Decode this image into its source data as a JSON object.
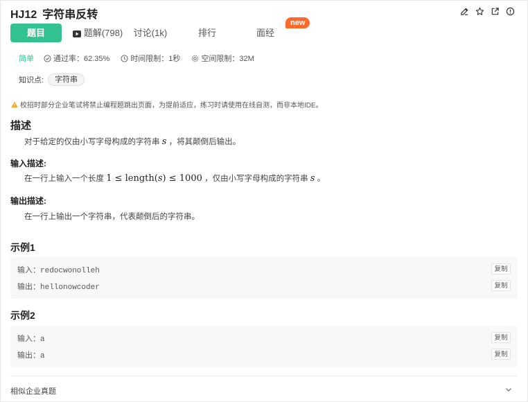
{
  "problem": {
    "id": "HJ12",
    "title": "字符串反转"
  },
  "tabs": [
    {
      "label": "题目",
      "active": true
    },
    {
      "label": "题解(798)",
      "active": false
    },
    {
      "label": "讨论(1k)",
      "active": false
    },
    {
      "label": "排行",
      "active": false
    },
    {
      "label": "面经",
      "active": false
    }
  ],
  "new_badge": "new",
  "meta": {
    "difficulty": "简单",
    "pass_rate": "通过率：62.35%",
    "time_limit": "时间限制：1秒",
    "memory_limit": "空间限制：32M"
  },
  "knowledge": {
    "label": "知识点:",
    "tag": "字符串"
  },
  "warning": "校招时部分企业笔试将禁止编程题跳出页面，为提前适应，练习时请使用在线自测，而非本地IDE。",
  "description": {
    "heading": "描述",
    "text_before": "对于给定的仅由小写字母构成的字符串",
    "var": "s",
    "text_after": "，将其颠倒后输出。"
  },
  "input_desc": {
    "heading": "输入描述:",
    "text_before": "在一行上输入一个长度",
    "math_left": "1 ≤ ",
    "math_func": "length",
    "math_arg": "s",
    "math_right": " ≤ 1000",
    "text_middle": "，仅由小写字母构成的字符串",
    "var": "s",
    "text_after": "。"
  },
  "output_desc": {
    "heading": "输出描述:",
    "text": "在一行上输出一个字符串，代表颠倒后的字符串。"
  },
  "examples": [
    {
      "heading": "示例1",
      "input_label": "输入：",
      "input": "redocwonolleh",
      "output_label": "输出：",
      "output": "hellonowcoder",
      "copy_label": "复制"
    },
    {
      "heading": "示例2",
      "input_label": "输入：",
      "input": "a",
      "output_label": "输出：",
      "output": "a",
      "copy_label": "复制"
    }
  ],
  "similar": "相似企业真题",
  "icons": {
    "edit": "edit-icon",
    "star": "star-icon",
    "share": "external-link-icon",
    "info": "info-icon",
    "video": "video-icon",
    "check": "check-circle-icon",
    "clock": "clock-icon",
    "memory": "gear-icon",
    "warning": "warning-icon",
    "chevron": "chevron-down-icon"
  },
  "colors": {
    "accent": "#32c28f",
    "badge": "#ff6a2a",
    "warning": "#f5a623"
  }
}
